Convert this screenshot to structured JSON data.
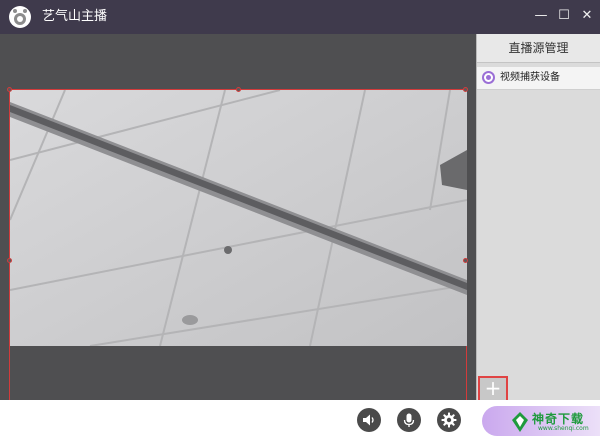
{
  "window": {
    "title": "艺气山主播",
    "minimize_glyph": "—",
    "maximize_glyph": "☐",
    "close_glyph": "✕"
  },
  "source_panel": {
    "header": "直播源管理",
    "items": [
      {
        "label": "视频捕获设备",
        "selected": true
      }
    ],
    "add_glyph": "+"
  },
  "controls": {
    "speaker_icon": "speaker-icon",
    "mic_icon": "microphone-icon",
    "settings_icon": "gear-icon"
  },
  "watermark": {
    "text": "神奇下载",
    "subtext": "www.shenqi.com"
  },
  "colors": {
    "titlebar": "#3f3a4c",
    "stage": "#4f4f51",
    "selection_border": "#d33b3b",
    "accent": "#9b6fd6",
    "watermark": "#1f9a3d"
  }
}
